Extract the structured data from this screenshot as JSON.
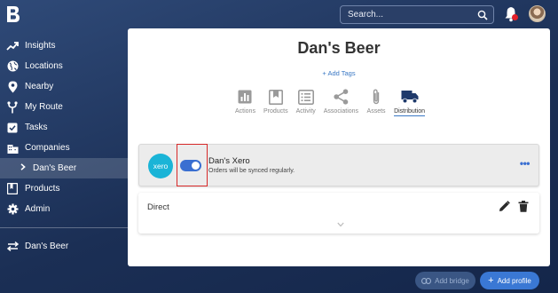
{
  "search": {
    "placeholder": "Search..."
  },
  "sidebar": {
    "items": [
      {
        "label": "Insights",
        "icon": "trending-up-icon"
      },
      {
        "label": "Locations",
        "icon": "globe-icon"
      },
      {
        "label": "Nearby",
        "icon": "map-pin-icon"
      },
      {
        "label": "My Route",
        "icon": "route-icon"
      },
      {
        "label": "Tasks",
        "icon": "checkbox-icon"
      },
      {
        "label": "Companies",
        "icon": "building-icon"
      },
      {
        "label": "Dan's Beer",
        "icon": "chevron-right-icon",
        "selected": true
      },
      {
        "label": "Products",
        "icon": "book-icon"
      },
      {
        "label": "Admin",
        "icon": "gear-icon"
      }
    ],
    "switch_label": "Dan's Beer"
  },
  "main": {
    "title": "Dan's Beer",
    "add_tags": "+ Add Tags",
    "tabs": [
      {
        "label": "Actions",
        "icon": "bar-chart-icon"
      },
      {
        "label": "Products",
        "icon": "bookmark-icon"
      },
      {
        "label": "Activity",
        "icon": "list-icon"
      },
      {
        "label": "Associations",
        "icon": "share-icon"
      },
      {
        "label": "Assets",
        "icon": "paperclip-icon"
      },
      {
        "label": "Distribution",
        "icon": "truck-icon",
        "active": true
      }
    ],
    "integration": {
      "logo_text": "xero",
      "name": "Dan's Xero",
      "description": "Orders will be synced regularly.",
      "enabled": true
    },
    "direct_label": "Direct"
  },
  "buttons": {
    "add_bridge": "Add bridge",
    "add_profile": "Add profile"
  },
  "colors": {
    "accent": "#3a6fd1",
    "xero": "#1ab4d7",
    "highlight": "#d62828"
  }
}
